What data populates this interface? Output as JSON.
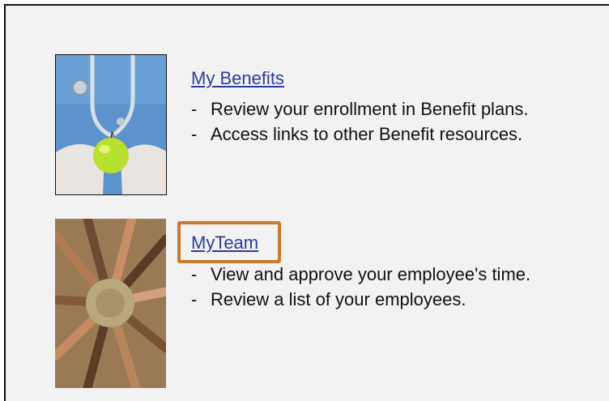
{
  "sections": {
    "benefits": {
      "link_label": "My Benefits",
      "bullets": [
        "Review your enrollment in Benefit plans.",
        "Access links to other Benefit resources."
      ],
      "image_icon": "medical-apple-photo"
    },
    "team": {
      "link_label": "MyTeam",
      "bullets": [
        "View and approve your employee's time.",
        "Review a list of your employees."
      ],
      "image_icon": "team-hands-photo"
    }
  },
  "bullet_marker": "-",
  "colors": {
    "link": "#2a3c9e",
    "highlight": "#cc7a2e",
    "panel_background": "#f2f2f3"
  }
}
